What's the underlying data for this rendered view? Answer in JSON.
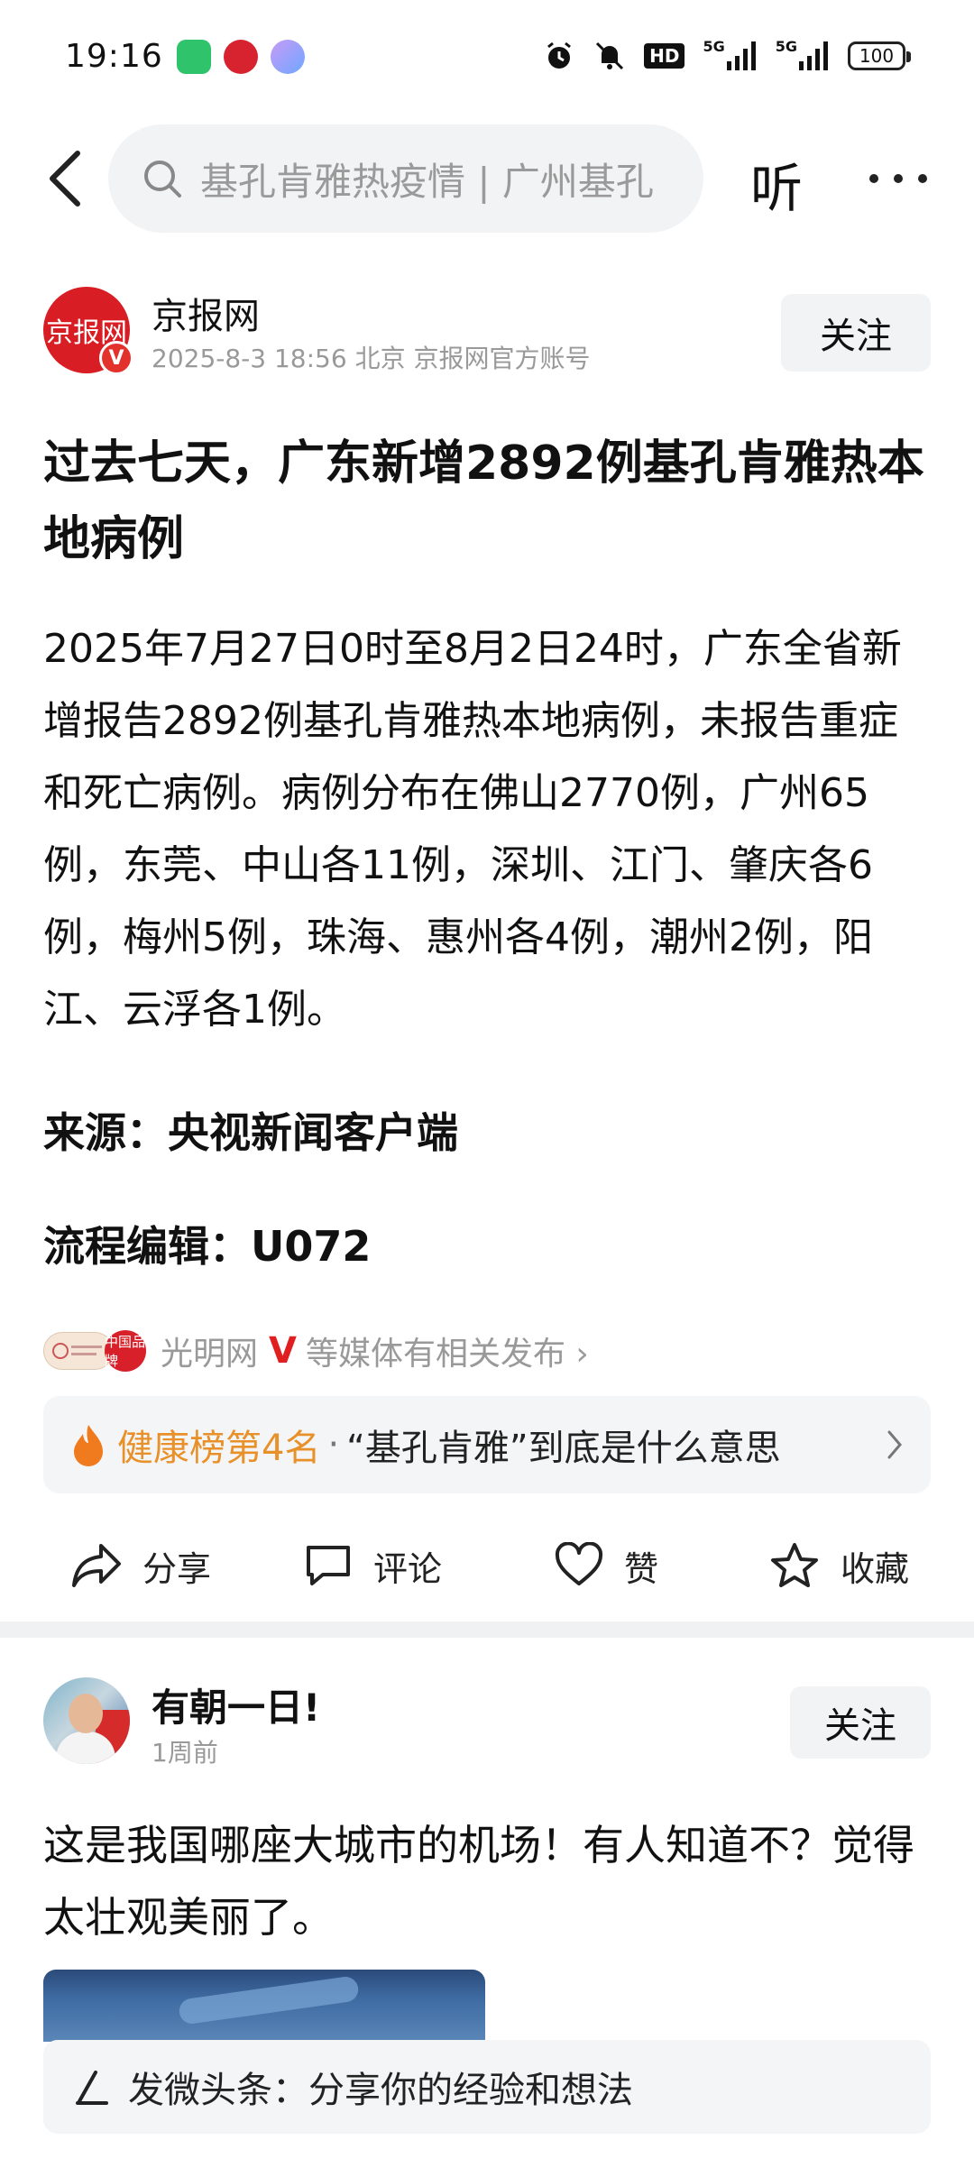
{
  "status_bar": {
    "time": "19:16",
    "battery": "100",
    "hd_label": "HD",
    "network_1": "5G",
    "network_2": "5G"
  },
  "nav": {
    "search_text": "基孔肯雅热疫情 | 广州基孔",
    "listen_label": "听"
  },
  "author": {
    "logo_text": "京报网",
    "name": "京报网",
    "meta": "2025-8-3   18:56   北京   京报网官方账号",
    "follow_label": "关注"
  },
  "article": {
    "title": "过去七天，广东新增2892例基孔肯雅热本地病例",
    "body": "2025年7月27日0时至8月2日24时，广东全省新增报告2892例基孔肯雅热本地病例，未报告重症和死亡病例。病例分布在佛山2770例，广州65例，东莞、中山各11例，深圳、江门、肇庆各6例，梅州5例，珠海、惠州各4例，潮州2例，阳江、云浮各1例。",
    "source": "来源：央视新闻客户端",
    "editor": "流程编辑：U072"
  },
  "related": {
    "logo2_text": "中国品牌",
    "media_name": "光明网",
    "v_mark": "V",
    "text": "等媒体有相关发布 ›"
  },
  "hot": {
    "rank": "健康榜第4名",
    "separator": "·",
    "text": "“基孔肯雅”到底是什么意思"
  },
  "actions": {
    "share": "分享",
    "comment": "评论",
    "like": "赞",
    "favorite": "收藏"
  },
  "post": {
    "name": "有朝一日!",
    "time": "1周前",
    "follow_label": "关注",
    "text": "这是我国哪座大城市的机场！有人知道不？觉得太壮观美丽了。"
  },
  "compose": {
    "placeholder": "发微头条：分享你的经验和想法"
  },
  "colors": {
    "brand_red": "#d81e24",
    "hot_orange": "#e8912a",
    "muted_gray": "#999999",
    "card_bg": "#f4f5f7"
  }
}
